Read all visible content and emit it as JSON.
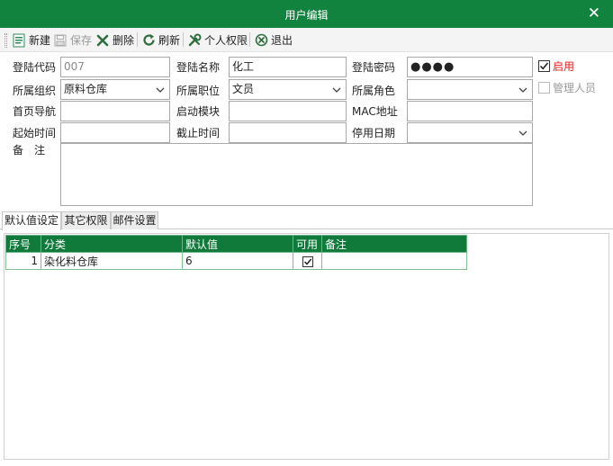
{
  "window": {
    "title": "用户编辑"
  },
  "toolbar": {
    "new": "新建",
    "save": "保存",
    "delete": "删除",
    "refresh": "刷新",
    "permissions": "个人权限",
    "exit": "退出"
  },
  "form": {
    "login_code_label": "登陆代码",
    "login_code_value": "007",
    "login_name_label": "登陆名称",
    "login_name_value": "化工",
    "login_password_label": "登陆密码",
    "login_password_value": "●●●●",
    "enabled_label": "启用",
    "enabled": true,
    "org_label": "所属组织",
    "org_value": "原料仓库",
    "position_label": "所属职位",
    "position_value": "文员",
    "role_label": "所属角色",
    "role_value": "",
    "admin_label": "管理人员",
    "admin": false,
    "homepage_label": "首页导航",
    "homepage_value": "",
    "startup_label": "启动模块",
    "startup_value": "",
    "mac_label": "MAC地址",
    "mac_value": "",
    "start_time_label": "起始时间",
    "start_time_value": "",
    "end_time_label": "截止时间",
    "end_time_value": "",
    "disable_date_label": "停用日期",
    "disable_date_value": "",
    "remarks_label": "备　注",
    "remarks_value": ""
  },
  "tabs": [
    "默认值设定",
    "其它权限",
    "邮件设置"
  ],
  "grid": {
    "columns": [
      "序号",
      "分类",
      "默认值",
      "可用",
      "备注"
    ],
    "rows": [
      {
        "index": "1",
        "category": "染化料仓库",
        "default": "6",
        "enabled": true,
        "remark": ""
      }
    ]
  },
  "colors": {
    "title_bar": "#12833f",
    "grid_header": "#0f7a3a",
    "enabled_text": "#e02020"
  }
}
